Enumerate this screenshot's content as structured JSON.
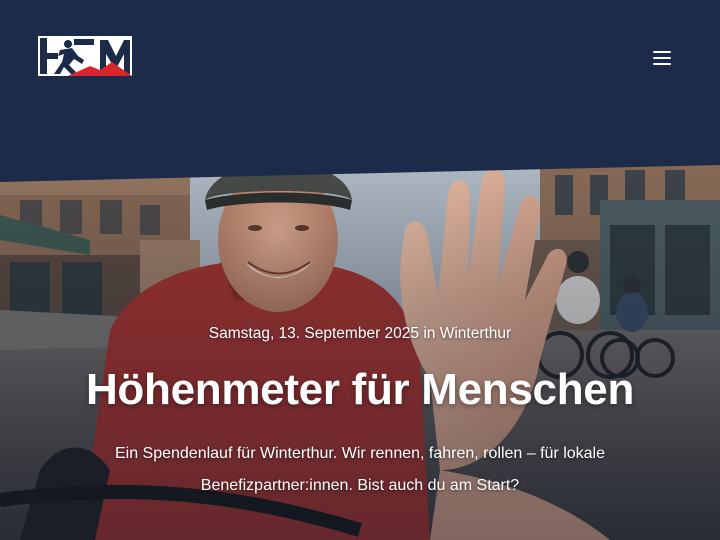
{
  "header": {
    "logo_icon": "hfm-runner-logo-icon",
    "menu_icon": "hamburger-menu-icon",
    "background_color": "#1c2b4a",
    "accent_color": "#d9262c"
  },
  "hero": {
    "image_description_icon": "cyclist-high-five-photo",
    "date_line": "Samstag, 13. September 2025 in Winterthur",
    "title": "Höhenmeter für Menschen",
    "intro": "Ein Spendenlauf für Winterthur. Wir rennen, fahren, rollen – für lokale Benefizpartner:innen. Bist auch du am Start?"
  }
}
